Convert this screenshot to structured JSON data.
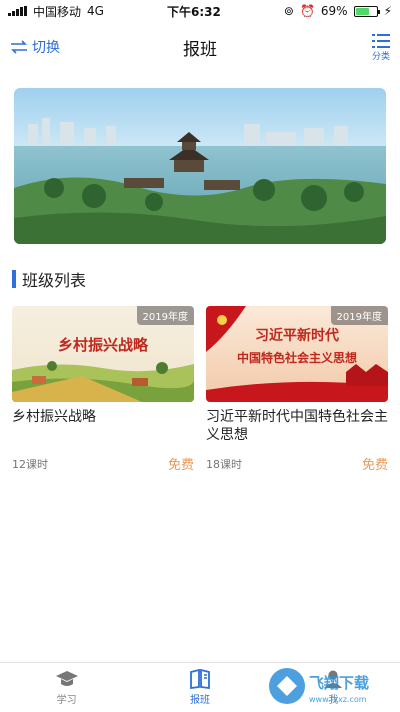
{
  "status_bar": {
    "carrier": "中国移动",
    "network": "4G",
    "time": "下午6:32",
    "battery": "69%",
    "battery_level": 0.69
  },
  "nav": {
    "left_label": "切换",
    "title": "报班",
    "right_label": "分类"
  },
  "section": {
    "title": "班级列表"
  },
  "courses": [
    {
      "title": "乡村振兴战略",
      "year": "2019年度",
      "hours": "12课时",
      "price": "免费",
      "thumb_text": "乡村振兴战略"
    },
    {
      "title": "习近平新时代中国特色社会主义思想",
      "year": "2019年度",
      "hours": "18课时",
      "price": "免费",
      "thumb_line1": "习近平新时代",
      "thumb_line2": "中国特色社会主义思想"
    }
  ],
  "tabs": [
    {
      "label": "学习"
    },
    {
      "label": "报班"
    },
    {
      "label": "我"
    }
  ],
  "watermark": {
    "text": "飞翔下载",
    "sub": "www.fxxz.com"
  }
}
